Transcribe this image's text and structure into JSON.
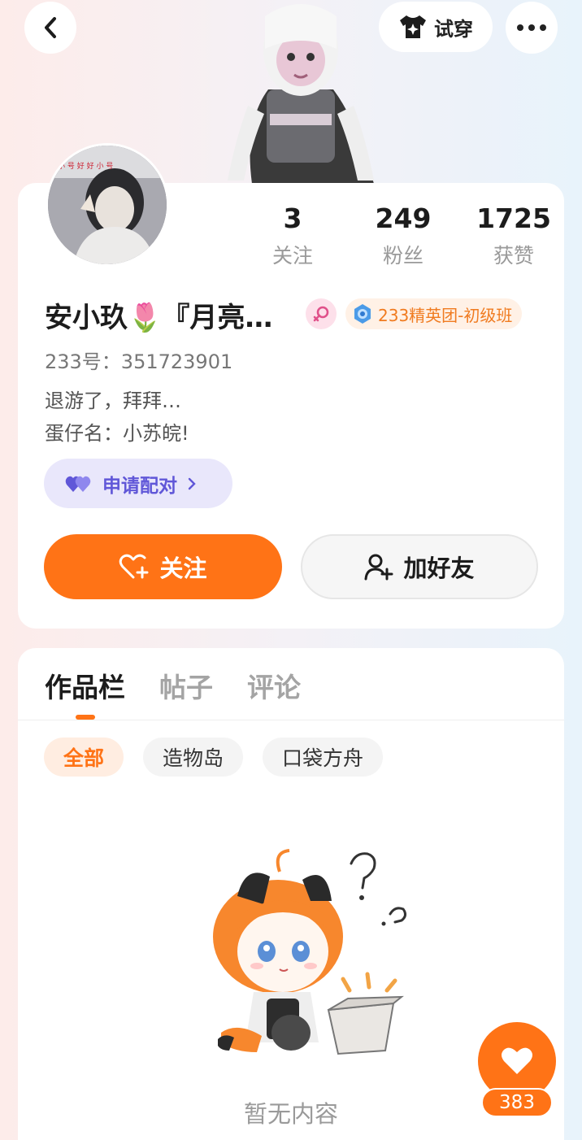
{
  "header": {
    "back_icon": "chevron-left-icon",
    "tryon_label": "试穿",
    "tryon_icon": "shirt-sparkle-icon",
    "more_icon": "more-dots-icon"
  },
  "profile": {
    "stats": [
      {
        "value": "3",
        "label": "关注"
      },
      {
        "value": "249",
        "label": "粉丝"
      },
      {
        "value": "1725",
        "label": "获赞"
      }
    ],
    "name": "安小玖🌷『月亮…",
    "gender_icon": "female-icon",
    "level_badge": "233精英团-初级班",
    "uid": "233号：351723901",
    "bio_lines": [
      "退游了，拜拜…",
      "蛋仔名：小苏皖!"
    ],
    "pair_label": "申请配对",
    "follow_label": "关注",
    "add_friend_label": "加好友"
  },
  "works": {
    "tabs": [
      {
        "label": "作品栏",
        "active": true
      },
      {
        "label": "帖子",
        "active": false
      },
      {
        "label": "评论",
        "active": false
      }
    ],
    "filters": [
      {
        "label": "全部",
        "active": true
      },
      {
        "label": "造物岛",
        "active": false
      },
      {
        "label": "口袋方舟",
        "active": false
      }
    ],
    "empty_text": "暂无内容"
  },
  "like": {
    "count": "383"
  },
  "colors": {
    "accent": "#ff7316",
    "pair_purple": "#6057d8",
    "badge_orange": "#f07b20"
  }
}
